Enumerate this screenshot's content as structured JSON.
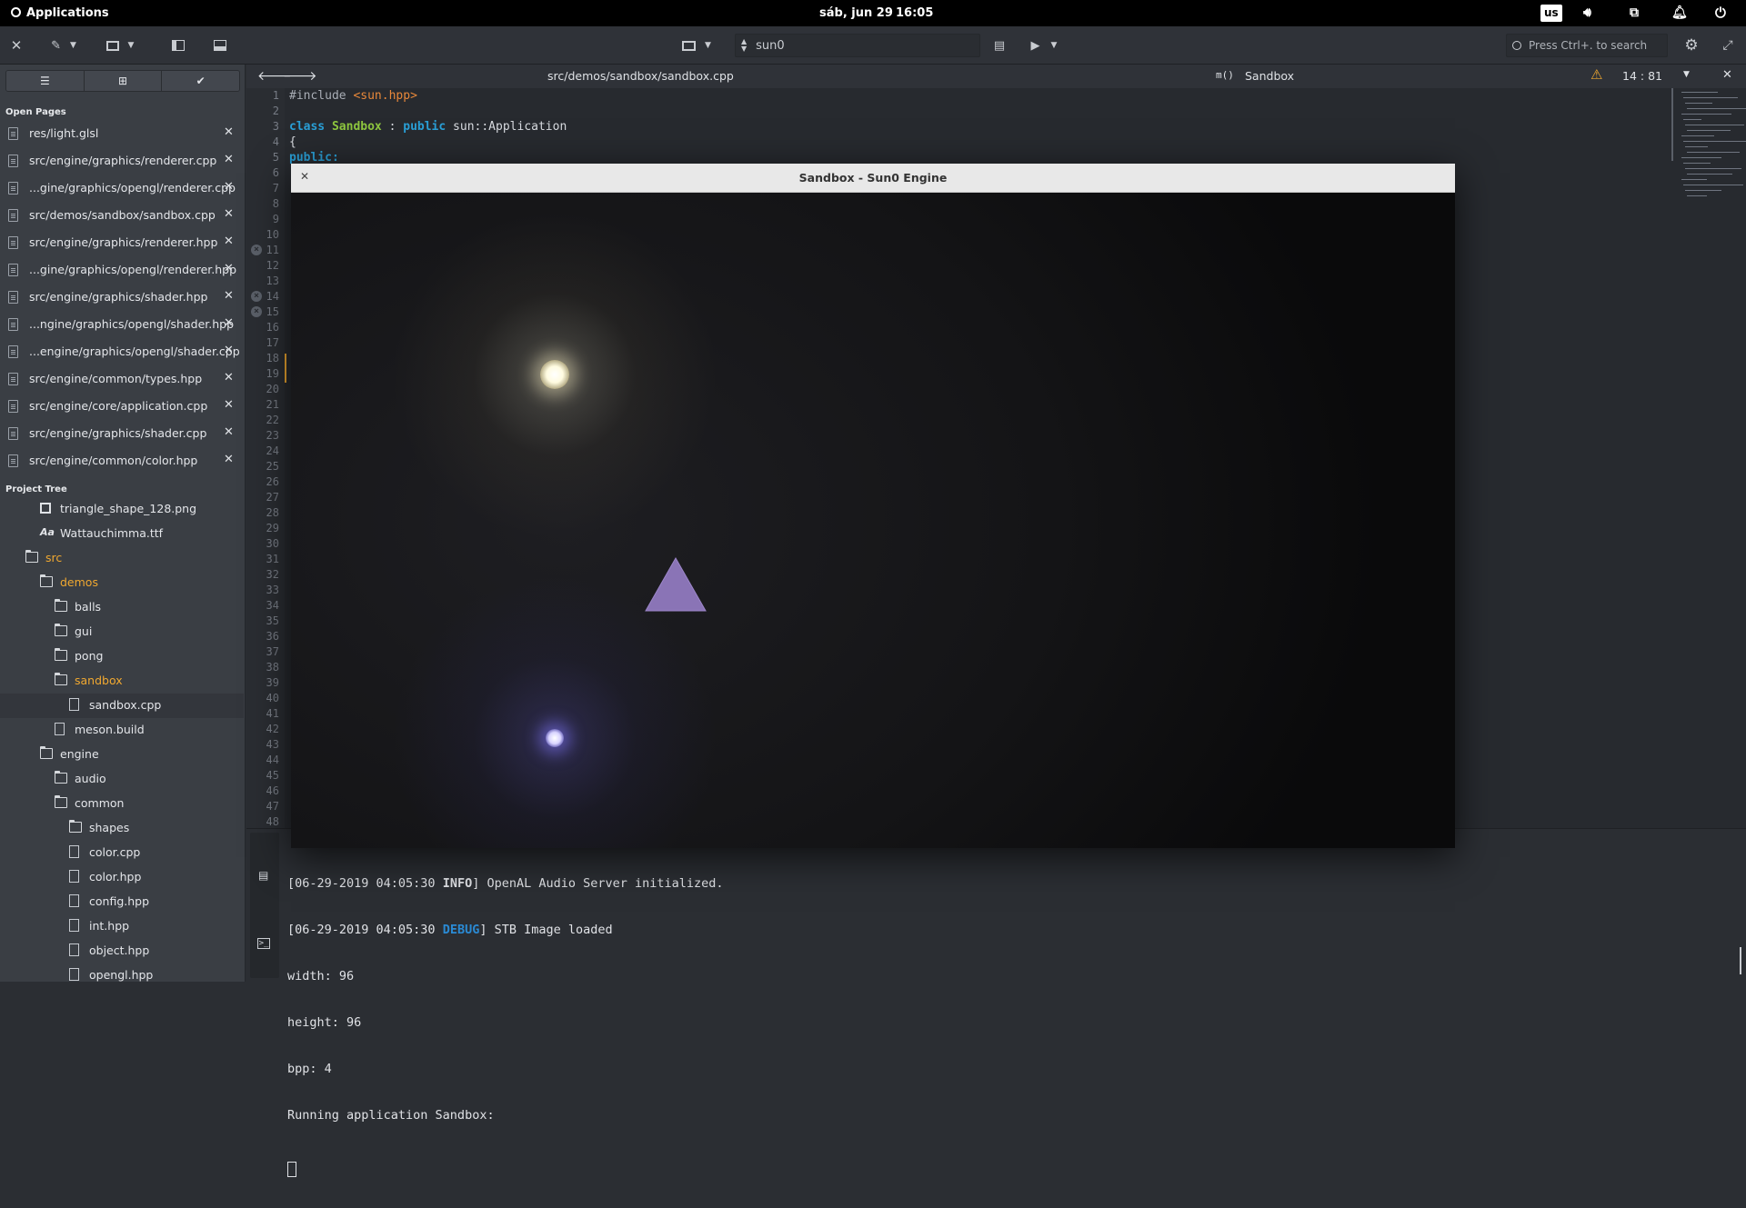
{
  "panel": {
    "applications": "Applications",
    "date": "sáb, jun 29",
    "time": "16:05",
    "keyboard": "us"
  },
  "header": {
    "target": "sun0",
    "search_placeholder": "Press Ctrl+. to search"
  },
  "sidebar": {
    "open_pages_title": "Open Pages",
    "open_pages": [
      "res/light.glsl",
      "src/engine/graphics/renderer.cpp",
      "...gine/graphics/opengl/renderer.cpp",
      "src/demos/sandbox/sandbox.cpp",
      "src/engine/graphics/renderer.hpp",
      "...gine/graphics/opengl/renderer.hpp",
      "src/engine/graphics/shader.hpp",
      "...ngine/graphics/opengl/shader.hpp",
      "...engine/graphics/opengl/shader.cpp",
      "src/engine/common/types.hpp",
      "src/engine/core/application.cpp",
      "src/engine/graphics/shader.cpp",
      "src/engine/common/color.hpp"
    ],
    "project_tree_title": "Project Tree",
    "tree": [
      {
        "label": "triangle_shape_128.png",
        "kind": "image",
        "level": 2
      },
      {
        "label": "Wattauchimma.ttf",
        "kind": "font",
        "level": 2
      },
      {
        "label": "src",
        "kind": "folder-open",
        "level": 1
      },
      {
        "label": "demos",
        "kind": "folder-open",
        "level": 2
      },
      {
        "label": "balls",
        "kind": "folder",
        "level": 3
      },
      {
        "label": "gui",
        "kind": "folder",
        "level": 3
      },
      {
        "label": "pong",
        "kind": "folder",
        "level": 3
      },
      {
        "label": "sandbox",
        "kind": "folder-open",
        "level": 3
      },
      {
        "label": "sandbox.cpp",
        "kind": "file",
        "level": 4
      },
      {
        "label": "meson.build",
        "kind": "file",
        "level": 3
      },
      {
        "label": "engine",
        "kind": "folder",
        "level": 2
      },
      {
        "label": "audio",
        "kind": "folder",
        "level": 3
      },
      {
        "label": "common",
        "kind": "folder",
        "level": 3
      },
      {
        "label": "shapes",
        "kind": "folder",
        "level": 4
      },
      {
        "label": "color.cpp",
        "kind": "file",
        "level": 4
      },
      {
        "label": "color.hpp",
        "kind": "file",
        "level": 4
      },
      {
        "label": "config.hpp",
        "kind": "file",
        "level": 4
      },
      {
        "label": "int.hpp",
        "kind": "file",
        "level": 4
      },
      {
        "label": "object.hpp",
        "kind": "file",
        "level": 4
      },
      {
        "label": "opengl.hpp",
        "kind": "file",
        "level": 4
      }
    ]
  },
  "editor": {
    "path": "src/demos/sandbox/sandbox.cpp",
    "symbol": "Sandbox",
    "cursor": "14 : 81",
    "code": {
      "include_kw": "#include",
      "include_file": "<sun.hpp>",
      "class_kw": "class",
      "class_name": "Sandbox",
      "colon": ":",
      "public_kw": "public",
      "base": "sun::Application",
      "brace": "{",
      "public_label": "public:"
    },
    "line_count": 48
  },
  "sandbox_window": {
    "title": "Sandbox - Sun0 Engine"
  },
  "terminal": {
    "lines": [
      {
        "prefix": "[06-29-2019 04:05:30 ",
        "level": "INFO",
        "suffix": "] OpenAL Audio Server initialized."
      },
      {
        "prefix": "[06-29-2019 04:05:30 ",
        "level": "DEBUG",
        "suffix": "] STB Image loaded"
      }
    ],
    "plain": [
      "width: 96",
      "height: 96",
      "bpp: 4",
      "Running application Sandbox:"
    ]
  },
  "colors": {
    "accent_orange": "#f0a830",
    "debug_blue": "#2a8ad4",
    "keyword_blue": "#2a9fd6",
    "class_green": "#8ec63f",
    "string_orange": "#e8883a"
  }
}
